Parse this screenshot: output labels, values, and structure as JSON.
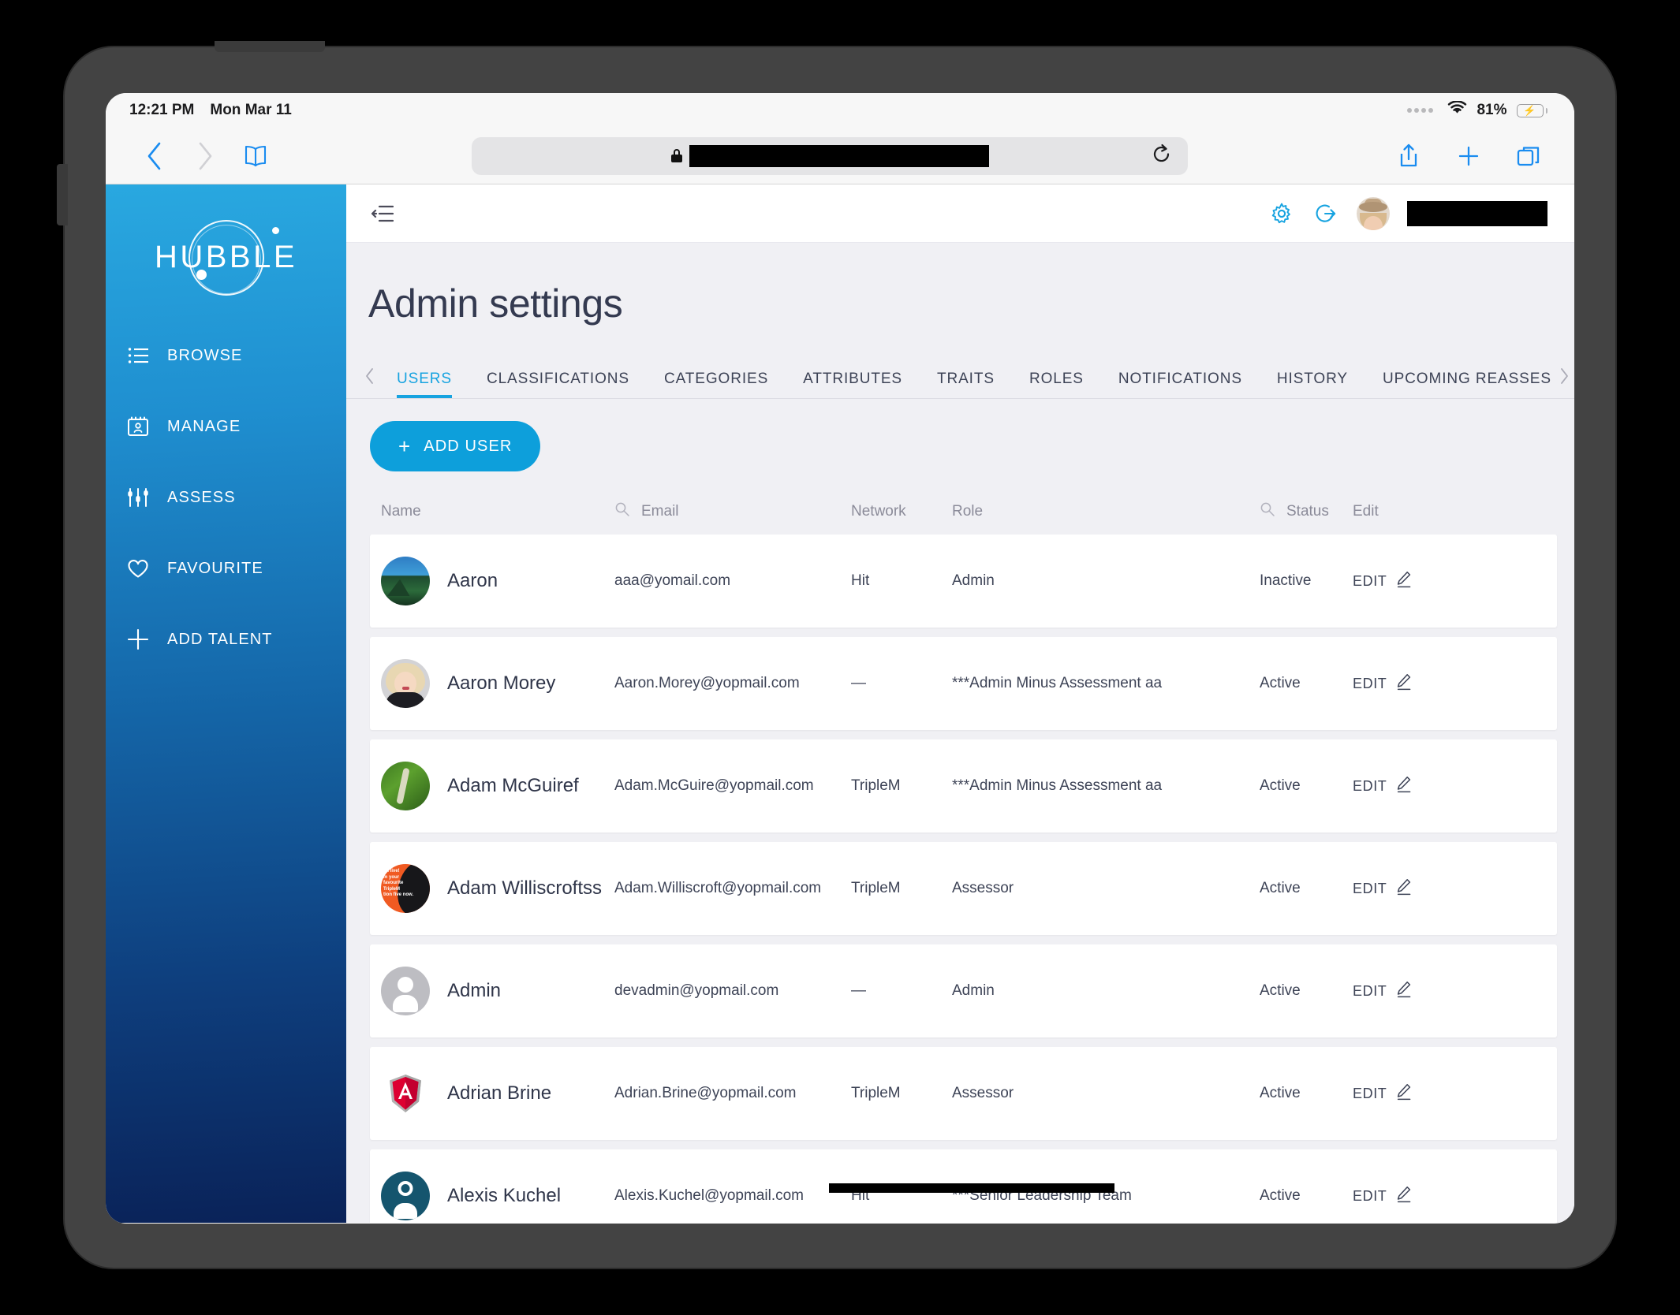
{
  "status_bar": {
    "time": "12:21 PM",
    "date": "Mon Mar 11",
    "battery_percent": "81%",
    "wifi_icon": "wifi-icon",
    "battery_icon": "battery-charging-icon"
  },
  "browser": {
    "back_icon": "chevron-left-icon",
    "forward_icon": "chevron-right-icon",
    "bookmarks_icon": "book-icon",
    "lock_icon": "lock-icon",
    "url_value": "",
    "url_redacted": true,
    "reload_icon": "reload-icon",
    "share_icon": "share-icon",
    "new_tab_icon": "plus-icon",
    "tabs_icon": "tabs-overview-icon"
  },
  "sidebar": {
    "logo_text": "HUBBLE",
    "items": [
      {
        "label": "BROWSE",
        "icon": "list-icon"
      },
      {
        "label": "MANAGE",
        "icon": "id-card-icon"
      },
      {
        "label": "ASSESS",
        "icon": "sliders-icon"
      },
      {
        "label": "FAVOURITE",
        "icon": "heart-icon"
      },
      {
        "label": "ADD TALENT",
        "icon": "plus-icon"
      }
    ]
  },
  "app_header": {
    "collapse_icon": "collapse-menu-icon",
    "settings_icon": "gear-icon",
    "logout_icon": "logout-icon",
    "avatar_icon": "user-avatar",
    "username": "",
    "username_redacted": true
  },
  "page": {
    "title": "Admin settings",
    "tabs_prev_icon": "chevron-left-icon",
    "tabs_next_icon": "chevron-right-icon",
    "tabs": [
      {
        "label": "USERS",
        "active": true
      },
      {
        "label": "CLASSIFICATIONS",
        "active": false
      },
      {
        "label": "CATEGORIES",
        "active": false
      },
      {
        "label": "ATTRIBUTES",
        "active": false
      },
      {
        "label": "TRAITS",
        "active": false
      },
      {
        "label": "ROLES",
        "active": false
      },
      {
        "label": "NOTIFICATIONS",
        "active": false
      },
      {
        "label": "HISTORY",
        "active": false
      },
      {
        "label": "UPCOMING REASSES",
        "active": false
      }
    ],
    "add_user_label": "ADD USER",
    "add_user_plus": "+"
  },
  "table": {
    "columns": {
      "name": "Name",
      "email": "Email",
      "network": "Network",
      "role": "Role",
      "status": "Status",
      "edit": "Edit"
    },
    "name_search_icon": "search-icon",
    "role_search_icon": "search-icon",
    "edit_label": "EDIT",
    "edit_icon": "pencil-icon",
    "rows": [
      {
        "name": "Aaron",
        "email": "aaa@yomail.com",
        "network": "Hit",
        "role": "Admin",
        "status": "Inactive",
        "avatar": "av-mountain"
      },
      {
        "name": "Aaron Morey",
        "email": "Aaron.Morey@yopmail.com",
        "network": "—",
        "role": "***Admin Minus Assessment aa",
        "status": "Active",
        "avatar": "av-blonde"
      },
      {
        "name": "Adam McGuiref",
        "email": "Adam.McGuire@yopmail.com",
        "network": "TripleM",
        "role": "***Admin Minus Assessment aa",
        "status": "Active",
        "avatar": "av-plant"
      },
      {
        "name": "Adam Williscroftss",
        "email": "Adam.Williscroft@yopmail.com",
        "network": "TripleM",
        "role": "Assessor",
        "status": "Active",
        "avatar": "av-orange"
      },
      {
        "name": "Admin",
        "email": "devadmin@yopmail.com",
        "network": "—",
        "role": "Admin",
        "status": "Active",
        "avatar": "av-gray"
      },
      {
        "name": "Adrian Brine",
        "email": "Adrian.Brine@yopmail.com",
        "network": "TripleM",
        "role": "Assessor",
        "status": "Active",
        "avatar": "av-angular"
      },
      {
        "name": "Alexis Kuchel",
        "email": "Alexis.Kuchel@yopmail.com",
        "network": "Hit",
        "role": "***Senior Leadership Team",
        "status": "Active",
        "avatar": "av-teal"
      }
    ]
  },
  "colors": {
    "brand_blue": "#0d9fdb",
    "tab_active": "#17a3e0",
    "sidebar_top": "#29a8e0",
    "sidebar_bottom": "#0a2258",
    "title_text": "#343a50",
    "page_bg": "#f0f0f4",
    "battery_green": "#34c759"
  }
}
